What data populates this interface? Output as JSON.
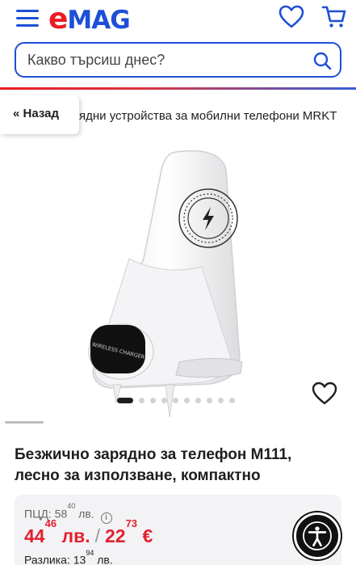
{
  "header": {
    "logo_e": "e",
    "logo_rest": "MAG",
    "icons": {
      "menu": "hamburger-menu-icon",
      "wishlist": "heart-icon",
      "cart": "cart-icon"
    }
  },
  "search": {
    "placeholder": "Какво търсиш днес?",
    "icon": "search-icon"
  },
  "breadcrumb": {
    "back_label": "« Назад",
    "trail_text": "ядни устройства за мобилни телефони MRKT"
  },
  "gallery": {
    "dot_count": 10,
    "active_index": 0,
    "image_label": "WIRELESS CHARGER"
  },
  "product": {
    "title": "Безжично зарядно за телефон M111, лесно за използване, компактно"
  },
  "pricing": {
    "rrp_label": "ПЦД: 58",
    "rrp_cents": "40",
    "rrp_currency": "лв.",
    "old_price_main": "44",
    "old_price_cents": "46",
    "old_price_currency": "лв.",
    "separator": "/",
    "eur_price_main": "22",
    "eur_price_cents": "73",
    "eur_price_currency": "€",
    "difference_label": "Разлика: 13",
    "difference_cents": "94",
    "difference_currency": "лв."
  },
  "colors": {
    "brand_blue": "#1e4fd6",
    "brand_red": "#ec1c24",
    "price_red": "#e3202f"
  }
}
